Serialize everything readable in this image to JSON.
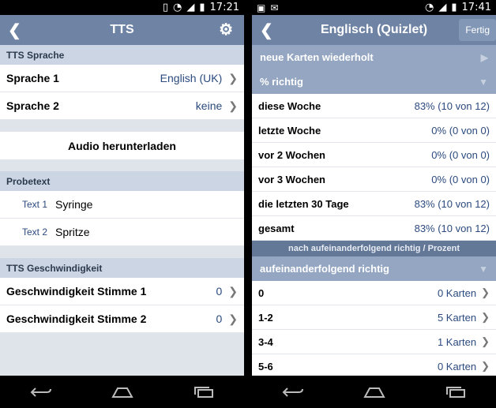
{
  "left": {
    "status": {
      "time": "17:21"
    },
    "title": "TTS",
    "section_language": "TTS Sprache",
    "languages": [
      {
        "label": "Sprache 1",
        "value": "English (UK)"
      },
      {
        "label": "Sprache 2",
        "value": "keine"
      }
    ],
    "download_label": "Audio herunterladen",
    "section_sample": "Probetext",
    "samples": [
      {
        "label": "Text 1",
        "value": "Syringe"
      },
      {
        "label": "Text 2",
        "value": "Spritze"
      }
    ],
    "section_speed": "TTS Geschwindigkeit",
    "speeds": [
      {
        "label": "Geschwindigkeit Stimme 1",
        "value": "0"
      },
      {
        "label": "Geschwindigkeit Stimme 2",
        "value": "0"
      }
    ]
  },
  "right": {
    "status": {
      "time": "17:41"
    },
    "title": "Englisch (Quizlet)",
    "done_label": "Fertig",
    "header_repeated": "neue Karten wiederholt",
    "header_percent": "% richtig",
    "stats": [
      {
        "label": "diese Woche",
        "value": "83% (10 von 12)"
      },
      {
        "label": "letzte Woche",
        "value": "0% (0 von 0)"
      },
      {
        "label": "vor 2 Wochen",
        "value": "0% (0 von 0)"
      },
      {
        "label": "vor 3 Wochen",
        "value": "0% (0 von 0)"
      },
      {
        "label": "die letzten 30 Tage",
        "value": "83% (10 von 12)"
      },
      {
        "label": "gesamt",
        "value": "83% (10 von 12)"
      }
    ],
    "dark_bar": "nach aufeinanderfolgend richtig / Prozent",
    "header_consecutive": "aufeinanderfolgend richtig",
    "consecutive": [
      {
        "label": "0",
        "value": "0 Karten"
      },
      {
        "label": "1-2",
        "value": "5 Karten"
      },
      {
        "label": "3-4",
        "value": "1 Karten"
      },
      {
        "label": "5-6",
        "value": "0 Karten"
      }
    ]
  },
  "colors": {
    "appbar": "#6f84a5",
    "section": "#ccd5e3",
    "value_text": "#2b4a7f",
    "header": "#94a6c1"
  }
}
